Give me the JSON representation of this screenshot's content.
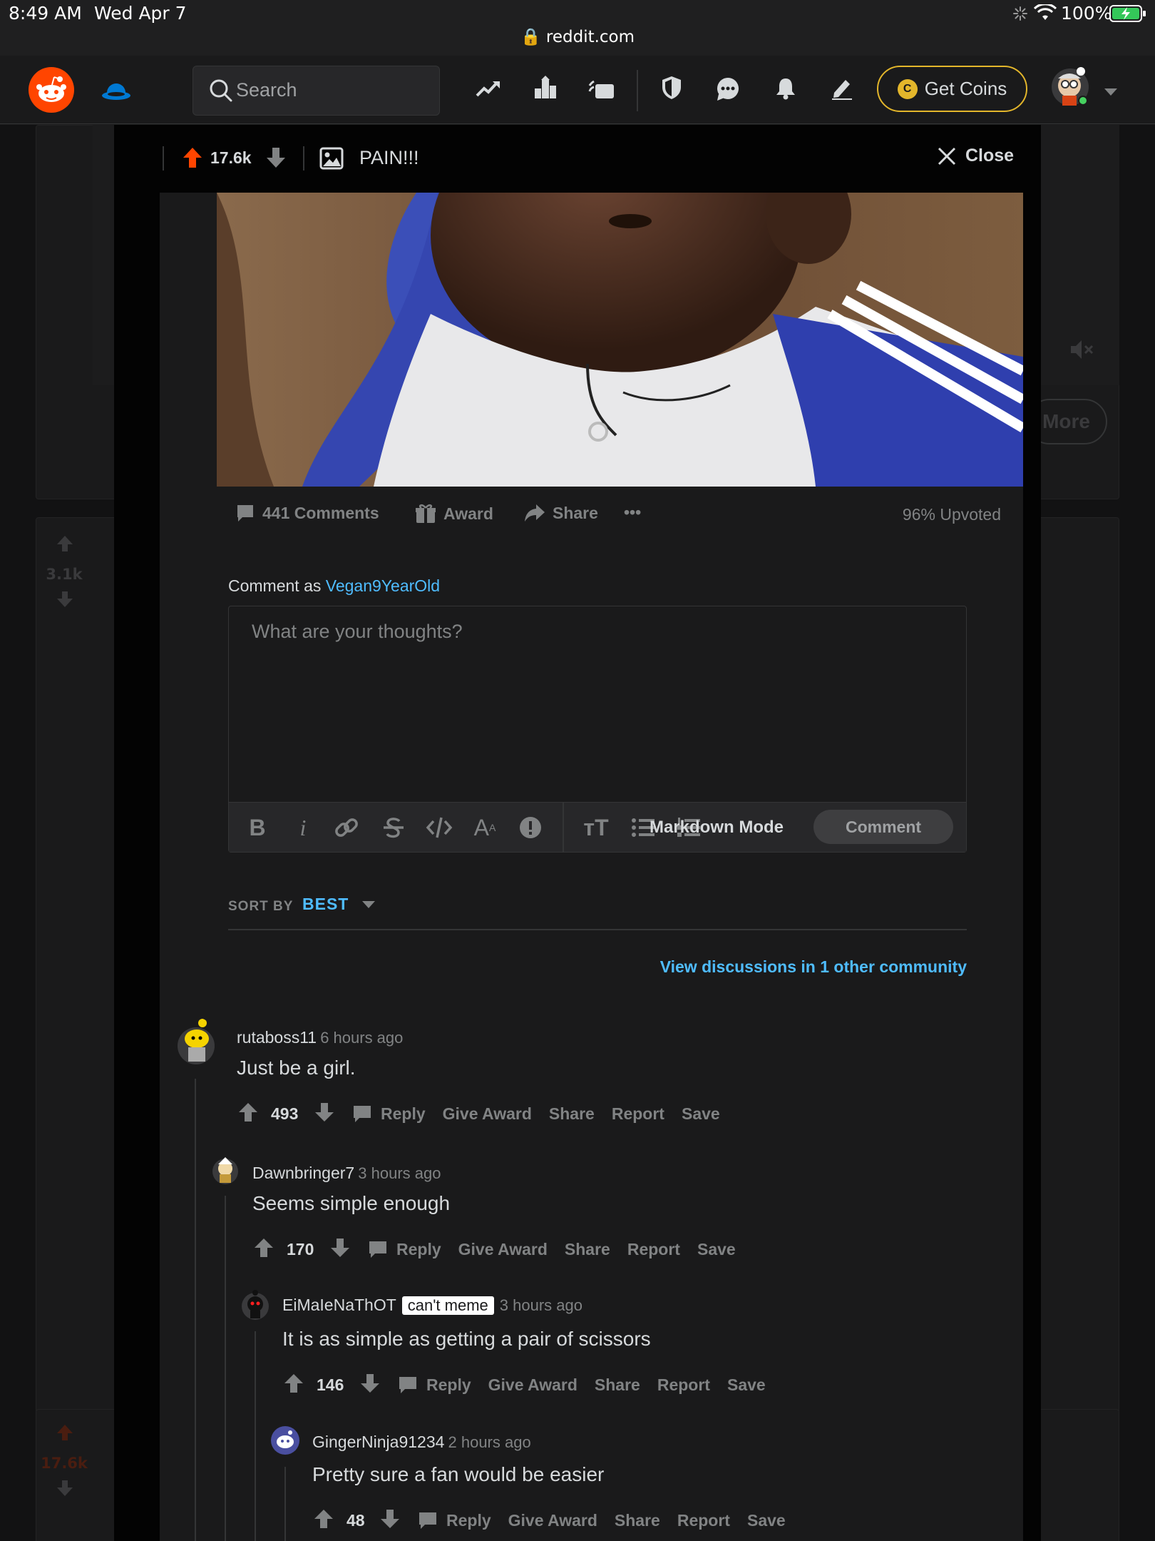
{
  "status_bar": {
    "time": "8:49 AM",
    "date": "Wed Apr 7",
    "battery": "100%",
    "url": "reddit.com"
  },
  "header": {
    "search_placeholder": "Search",
    "get_coins": "Get Coins",
    "coin_symbol": "C"
  },
  "post": {
    "score": "17.6k",
    "title": "PAIN!!!",
    "close_label": "Close",
    "comments_label": "441 Comments",
    "award_label": "Award",
    "share_label": "Share",
    "more_label": "•••",
    "upvoted_label": "96% Upvoted"
  },
  "composer": {
    "comment_as_label": "Comment as",
    "username": "Vegan9YearOld",
    "placeholder": "What are your thoughts?",
    "markdown_mode": "Markdown Mode",
    "comment_button": "Comment"
  },
  "sort": {
    "label": "SORT BY",
    "value": "BEST"
  },
  "other_community_link": "View discussions in 1 other community",
  "comment_actions": {
    "reply": "Reply",
    "give_award": "Give Award",
    "share": "Share",
    "report": "Report",
    "save": "Save"
  },
  "comments": [
    {
      "user": "rutaboss11",
      "time": "6 hours ago",
      "text": "Just be a girl.",
      "score": "493"
    },
    {
      "user": "Dawnbringer7",
      "time": "3 hours ago",
      "text": "Seems simple enough",
      "score": "170"
    },
    {
      "user": "EiMaIeNaThOT",
      "flair": "can't meme",
      "time": "3 hours ago",
      "text": "It is as simple as getting a pair of scissors",
      "score": "146"
    },
    {
      "user": "GingerNinja91234",
      "time": "2 hours ago",
      "text": "Pretty sure a fan would be easier",
      "score": "48"
    }
  ],
  "background_feed": {
    "score_1": "3.1k",
    "score_2": "17.6k",
    "more_button": "More"
  },
  "colors": {
    "accent_blue": "#4fbcff",
    "upvote_orange": "#ff4500",
    "coin_gold": "#e3b62b"
  }
}
